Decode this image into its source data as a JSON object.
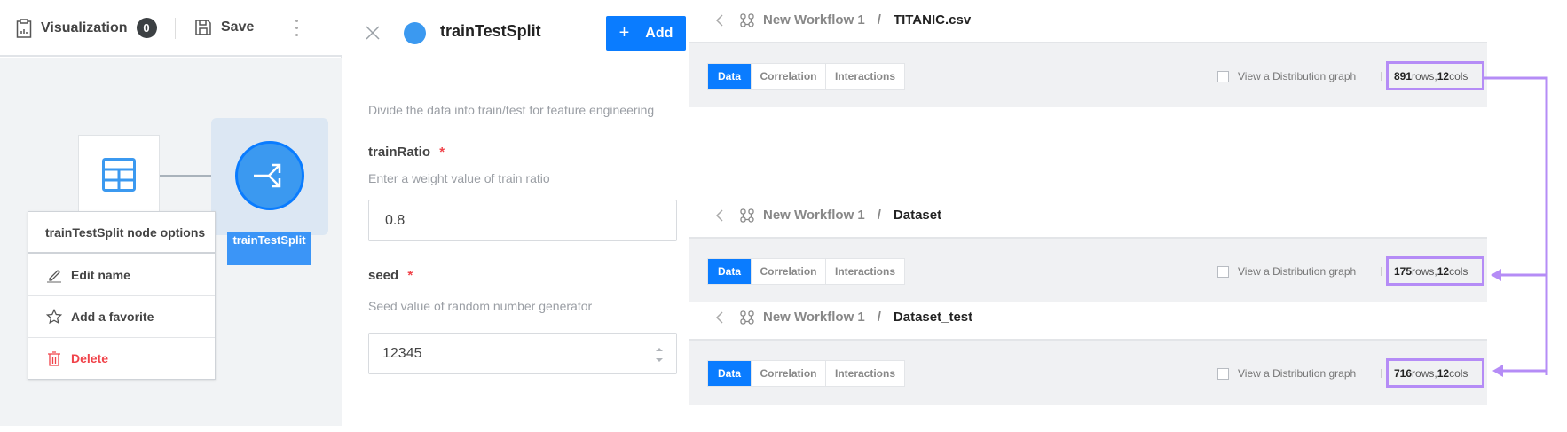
{
  "toolbar": {
    "visualization_label": "Visualization",
    "visualization_count": "0",
    "save_label": "Save"
  },
  "canvas": {
    "node_label": "trainTestSplit"
  },
  "context_menu": {
    "title": "trainTestSplit node options",
    "items": [
      {
        "label": "Edit name",
        "icon": "pencil-icon"
      },
      {
        "label": "Add a favorite",
        "icon": "star-icon"
      },
      {
        "label": "Delete",
        "icon": "trash-icon",
        "color": "#f0434a"
      }
    ]
  },
  "form": {
    "title": "trainTestSplit",
    "add_label": "Add",
    "description": "Divide the data into train/test for feature engineering",
    "fields": [
      {
        "label": "trainRatio",
        "required": "*",
        "hint": "Enter a weight value of train ratio",
        "value": "0.8"
      },
      {
        "label": "seed",
        "required": "*",
        "hint": "Seed value of random number generator",
        "value": "12345"
      }
    ]
  },
  "panels": [
    {
      "workflow": "New Workflow 1",
      "separator": "/",
      "dataset": "TITANIC.csv",
      "tabs": [
        "Data",
        "Correlation",
        "Interactions"
      ],
      "active_tab": "Data",
      "distribution_label": "View a Distribution graph",
      "rows": "891",
      "rows_label": " rows, ",
      "cols": "12",
      "cols_label": " cols"
    },
    {
      "workflow": "New Workflow 1",
      "separator": "/",
      "dataset": "Dataset",
      "tabs": [
        "Data",
        "Correlation",
        "Interactions"
      ],
      "active_tab": "Data",
      "distribution_label": "View a Distribution graph",
      "rows": "175",
      "rows_label": " rows, ",
      "cols": "12",
      "cols_label": " cols"
    },
    {
      "workflow": "New Workflow 1",
      "separator": "/",
      "dataset": "Dataset_test",
      "tabs": [
        "Data",
        "Correlation",
        "Interactions"
      ],
      "active_tab": "Data",
      "distribution_label": "View a Distribution graph",
      "rows": "716",
      "rows_label": " rows, ",
      "cols": "12",
      "cols_label": " cols"
    }
  ],
  "colors": {
    "accent": "#0a7cff",
    "node": "#3b99f0",
    "annotation": "#b58cf6",
    "danger": "#f0434a"
  }
}
